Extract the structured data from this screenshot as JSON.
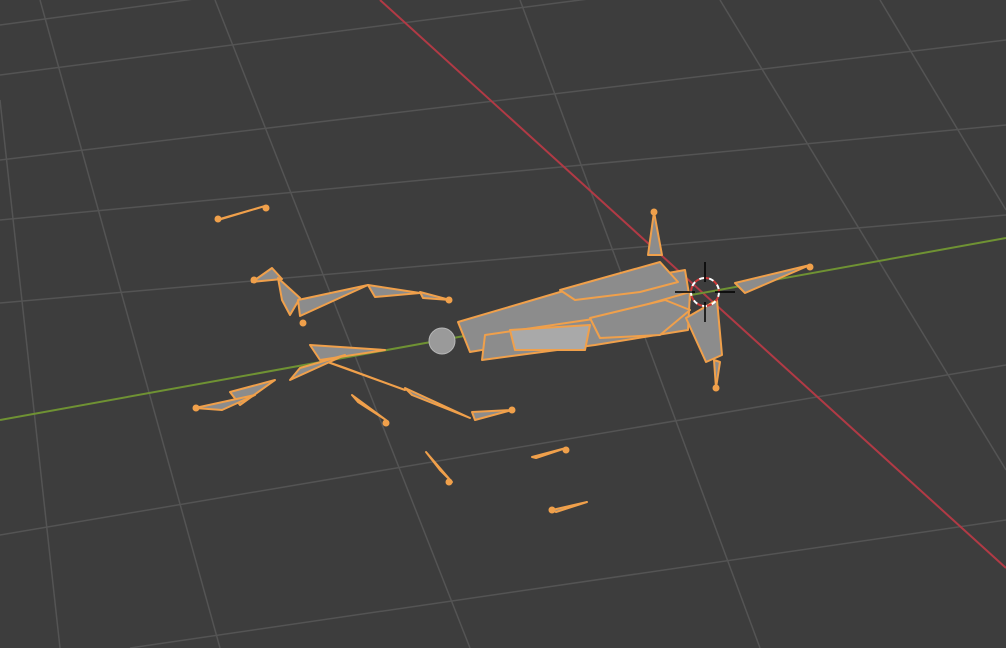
{
  "viewport": {
    "editor": "3D Viewport",
    "background_color": "#3d3d3d",
    "grid_color": "#545454",
    "x_axis_color": "#b13a45",
    "y_axis_color": "#6f9233",
    "selection_color": "#f0a04b",
    "bone_fill_color": "#8c8c8c",
    "object": "armature",
    "mode": "selected",
    "cursor_icon": "3d-cursor-icon"
  }
}
